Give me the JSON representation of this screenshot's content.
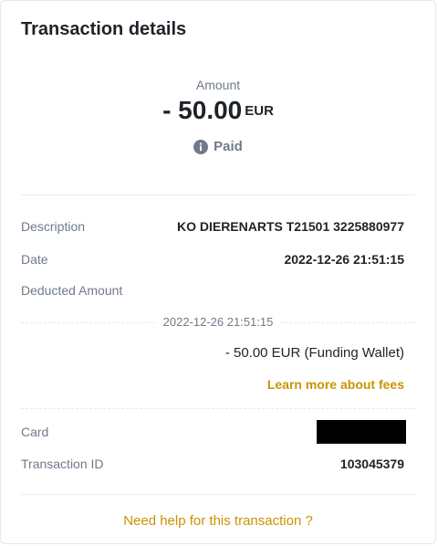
{
  "title": "Transaction details",
  "summary": {
    "amount_label": "Amount",
    "amount_value": "- 50.00",
    "currency": "EUR",
    "status_icon": "info-icon",
    "status": "Paid"
  },
  "details": {
    "description_label": "Description",
    "description_value": "KO DIERENARTS T21501 3225880977",
    "date_label": "Date",
    "date_value": "2022-12-26 21:51:15",
    "deducted_label": "Deducted Amount",
    "deducted_date": "2022-12-26 21:51:15",
    "deducted_value": "- 50.00 EUR (Funding Wallet)",
    "fees_link": "Learn more about fees",
    "card_label": "Card",
    "transaction_id_label": "Transaction ID",
    "transaction_id_value": "103045379"
  },
  "help_link": "Need help for this transaction ?",
  "colors": {
    "accent": "#c99400",
    "muted_text": "#707a8a",
    "primary_text": "#1e2329"
  }
}
